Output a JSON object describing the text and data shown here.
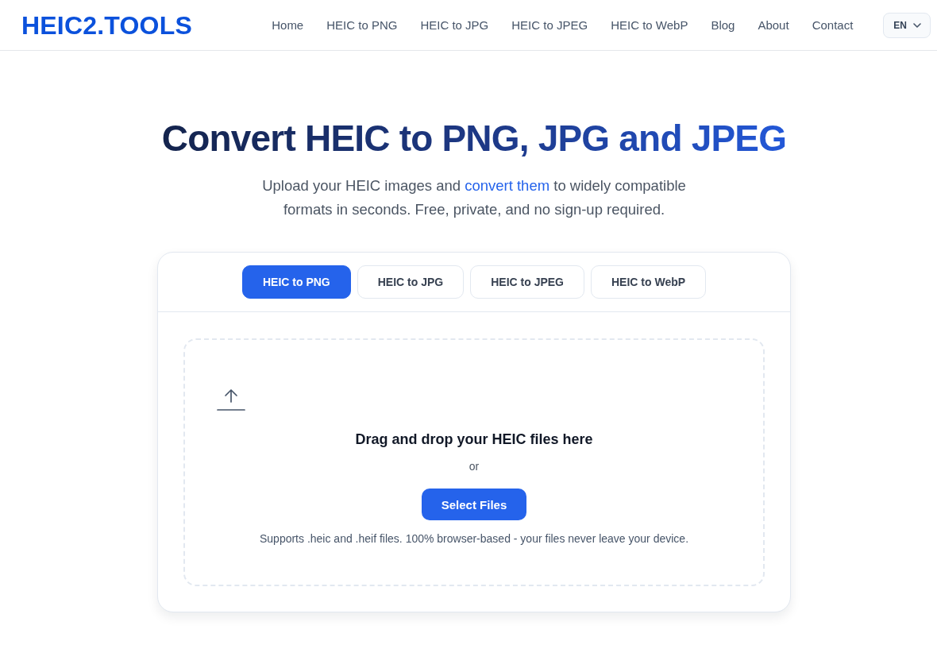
{
  "header": {
    "logo": "HEIC2.TOOLS",
    "nav": [
      "Home",
      "HEIC to PNG",
      "HEIC to JPG",
      "HEIC to JPEG",
      "HEIC to WebP",
      "Blog",
      "About",
      "Contact"
    ],
    "language": "EN"
  },
  "hero": {
    "title": "Convert HEIC to PNG, JPG and JPEG",
    "subtitle": {
      "before": "Upload your HEIC images and ",
      "link": "convert them",
      "after": " to widely compatible formats in seconds. Free, private, and no sign-up required."
    }
  },
  "converter": {
    "tabs": [
      {
        "label": "HEIC to PNG",
        "selected": true
      },
      {
        "label": "HEIC to JPG",
        "selected": false
      },
      {
        "label": "HEIC to JPEG",
        "selected": false
      },
      {
        "label": "HEIC to WebP",
        "selected": false
      }
    ],
    "dropzone": {
      "heading": "Drag and drop your HEIC files here",
      "separator": "or",
      "button": "Select Files",
      "note": "Supports .heic and .heif files. 100% browser-based - your files never leave your device."
    }
  }
}
